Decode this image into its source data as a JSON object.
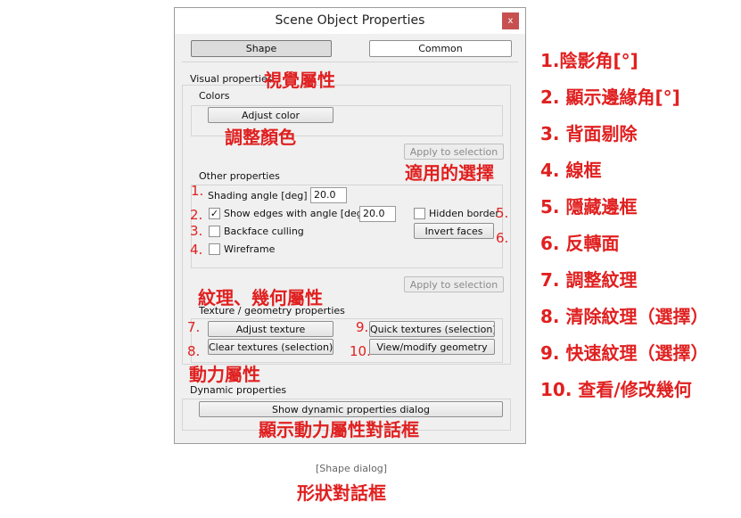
{
  "dialog": {
    "title": "Scene Object Properties",
    "close_glyph": "x",
    "tabs": [
      {
        "label": "Shape"
      },
      {
        "label": "Common"
      }
    ],
    "visual_section_label": "Visual properties",
    "colors_group_label": "Colors",
    "adjust_color_label": "Adjust color",
    "apply_selection_label": "Apply to selection",
    "other_group_label": "Other properties",
    "shading_angle": {
      "label": "Shading angle [deg]",
      "value": "20.0"
    },
    "show_edges": {
      "label": "Show edges with angle [deg]",
      "value": "20.0",
      "checked": true,
      "check_glyph": "✓"
    },
    "hidden_border": {
      "label": "Hidden border",
      "checked": false
    },
    "backface_culling": {
      "label": "Backface culling",
      "checked": false
    },
    "invert_faces_label": "Invert faces",
    "wireframe": {
      "label": "Wireframe",
      "checked": false
    },
    "apply_selection2_label": "Apply to selection",
    "texture_section_label": "Texture / geometry properties",
    "adjust_texture_label": "Adjust texture",
    "quick_textures_label": "Quick textures (selection)",
    "clear_textures_label": "Clear textures (selection)",
    "view_geometry_label": "View/modify geometry",
    "dynamic_section_label": "Dynamic properties",
    "show_dynamic_label": "Show dynamic properties dialog"
  },
  "annotations": {
    "visual": "視覺屬性",
    "adjust_color": "調整顏色",
    "apply_selection": "適用的選擇",
    "texture_geometry": "紋理、幾何屬性",
    "dynamic": "動力屬性",
    "show_dynamic": "顯示動力屬性對話框",
    "n1": "1.",
    "n2": "2.",
    "n3": "3.",
    "n4": "4.",
    "n5": "5.",
    "n6": "6.",
    "n7": "7.",
    "n8": "8.",
    "n9": "9.",
    "n10": "10."
  },
  "legend": [
    "1.陰影角[°]",
    "2. 顯示邊緣角[°]",
    "3. 背面剔除",
    "4. 線框",
    "5. 隱藏邊框",
    "6. 反轉面",
    "7. 調整紋理",
    "8. 清除紋理（選擇）",
    "9. 快速紋理（選擇）",
    "10. 查看/修改幾何"
  ],
  "caption": {
    "english": "[Shape dialog]",
    "chinese": "形狀對話框"
  },
  "colors": {
    "annotation": "#e02020",
    "close_button": "#c75050"
  }
}
